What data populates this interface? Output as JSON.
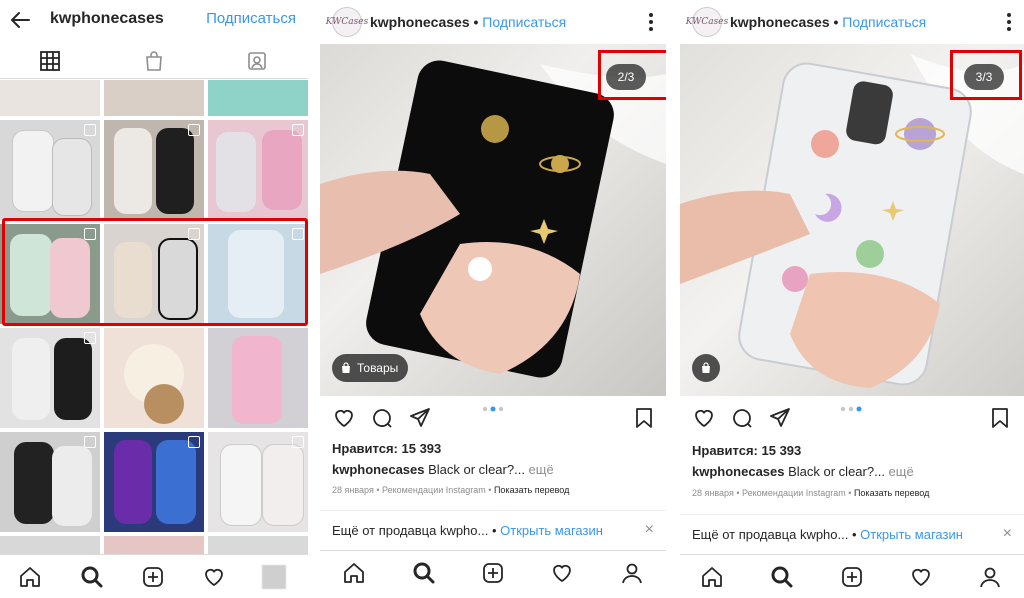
{
  "profile": {
    "username": "kwphonecases",
    "follow_label": "Подписаться"
  },
  "post": {
    "username": "kwphonecases",
    "separator": " • ",
    "follow_label": "Подписаться",
    "likes": "Нравится: 15 393",
    "caption_user": "kwphonecases",
    "caption_text": " Black or clear?... ",
    "caption_more": "ещё",
    "meta_date": "28 января",
    "meta_sep": " • ",
    "meta_source": "Рекомендации Instagram",
    "meta_sep2": " • ",
    "meta_translate": "Показать перевод",
    "seller_text": "Ещё от продавца kwpho...",
    "seller_sep": " • ",
    "seller_link": "Открыть магазин",
    "seller_close": "×"
  },
  "post2": {
    "counter": "2/3",
    "tag_label": "Товары"
  },
  "post3": {
    "counter": "3/3"
  },
  "avatar_text": "KWCases",
  "colors": {
    "accent": "#3897f0",
    "highlight": "#e10000",
    "text": "#262626",
    "muted": "#8e8e8e"
  },
  "icons": [
    "back-arrow-icon",
    "grid-icon",
    "shopping-bag-icon",
    "tagged-icon",
    "home-icon",
    "search-icon",
    "add-icon",
    "heart-icon",
    "profile-icon",
    "comment-icon",
    "share-icon",
    "bookmark-icon",
    "more-icon"
  ]
}
